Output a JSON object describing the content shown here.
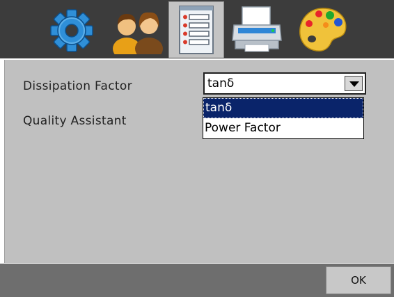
{
  "toolbar": {
    "buttons": [
      {
        "icon": "gear-icon"
      },
      {
        "icon": "users-icon"
      },
      {
        "icon": "checklist-icon",
        "active": true
      },
      {
        "icon": "printer-icon"
      },
      {
        "icon": "palette-icon"
      }
    ]
  },
  "settings": {
    "dissipation_label": "Dissipation Factor",
    "quality_label": "Quality Assistant",
    "combo_value": "tanδ",
    "options": [
      "tanδ",
      "Power Factor"
    ],
    "selected_index": 0
  },
  "footer": {
    "ok_label": "OK"
  },
  "colors": {
    "toolbar_bg": "#3c3c3c",
    "content_bg": "#c0c0c0",
    "footer_bg": "#6e6e6e",
    "selection_bg": "#0a246a"
  }
}
